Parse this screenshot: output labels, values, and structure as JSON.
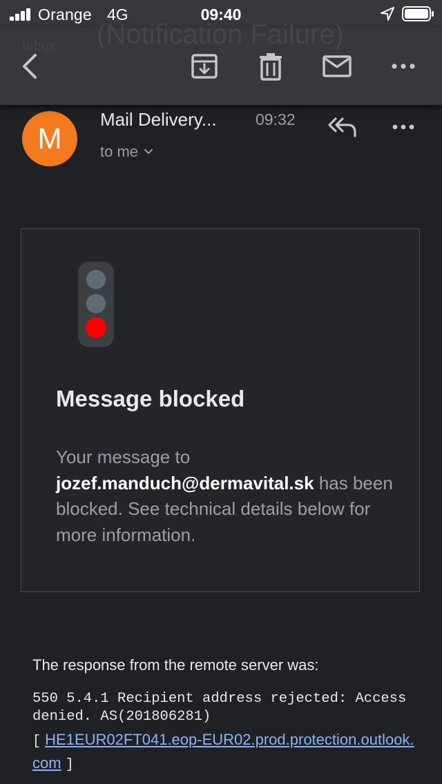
{
  "status_bar": {
    "carrier": "Orange",
    "network": "4G",
    "time": "09:40",
    "signal_icon": "signal-bars-icon",
    "location_icon": "location-arrow-icon",
    "battery_icon": "battery-icon"
  },
  "toolbar": {
    "ghost_subject": "(Notification Failure)",
    "ghost_folder": "Inbox",
    "icons": [
      "back-arrow-icon",
      "archive-icon",
      "trash-icon",
      "mark-unread-icon",
      "more-horizontal-icon"
    ]
  },
  "message": {
    "avatar_letter": "M",
    "avatar_color": "#f37a1f",
    "sender": "Mail Delivery...",
    "time": "09:32",
    "recipient": "to me",
    "reply_icon": "reply-all-icon",
    "more_icon": "more-horizontal-icon"
  },
  "card": {
    "icon": "traffic-light-icon",
    "title": "Message blocked",
    "body_prefix": "Your message to",
    "email": "jozef.manduch@dermavital.sk",
    "body_suffix": "has been blocked. See technical details below for more information."
  },
  "details": {
    "response_label": "The response from the remote server was:",
    "error_code": "550 5.4.1 Recipient address rejected: Access denied. AS(201806281)",
    "server_open": "[",
    "server_link": "HE1EUR02FT041.eop-EUR02.prod.protection.outlook.com",
    "server_close": "]"
  },
  "colors": {
    "background": "#202124",
    "toolbar": "#36383b",
    "card_border": "#4b4c4f",
    "link": "#8ab4f8",
    "signal_red": "#ff0000"
  }
}
